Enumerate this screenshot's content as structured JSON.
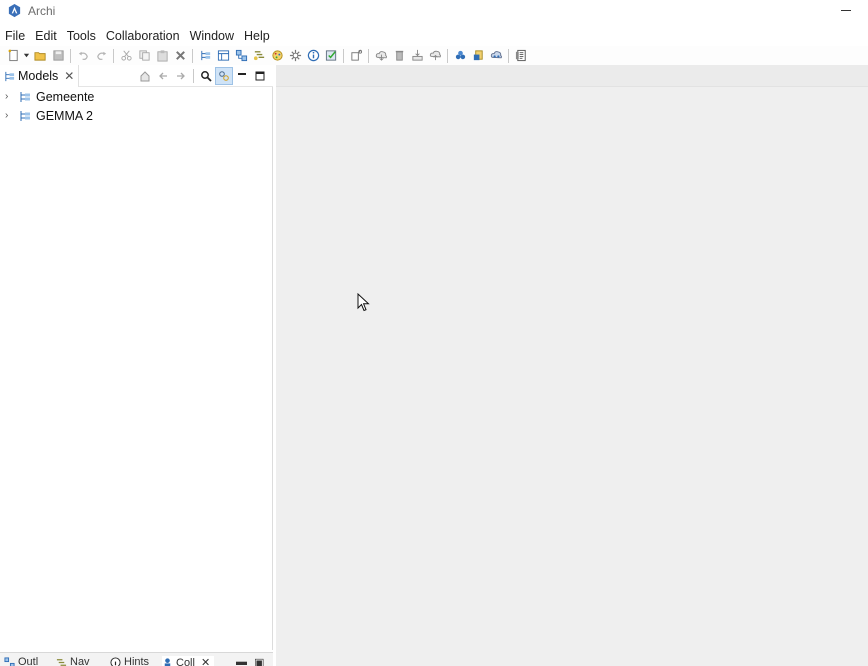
{
  "window": {
    "title": "Archi",
    "icon": "archi-logo-icon",
    "controls": [
      "minimize-icon"
    ]
  },
  "menubar": {
    "items": [
      "File",
      "Edit",
      "Tools",
      "Collaboration",
      "Window",
      "Help"
    ]
  },
  "toolbar": {
    "icons": [
      "new-icon",
      "open-icon",
      "save-icon",
      "undo-icon",
      "redo-icon",
      "cut-icon",
      "copy-icon",
      "paste-icon",
      "delete-icon",
      "models-tree-icon",
      "properties-icon",
      "outline-icon",
      "navigator-icon",
      "palette-icon",
      "hints-icon",
      "info-icon",
      "validator-icon",
      "viewpoint-icon",
      "collab-import-icon",
      "collab-delete-icon",
      "collab-commit-icon",
      "collab-refresh-icon",
      "collab-users-icon",
      "collab-lock-icon",
      "collab-sync-icon",
      "script-icon"
    ]
  },
  "models_panel": {
    "tab_label": "Models",
    "tools": [
      "home-icon",
      "back-icon",
      "forward-icon",
      "search-icon",
      "link-icon",
      "minimize-icon",
      "maximize-icon"
    ],
    "tree": [
      {
        "label": "Gemeente",
        "expanded": false
      },
      {
        "label": "GEMMA 2",
        "expanded": false
      }
    ]
  },
  "bottom_panel": {
    "tabs": [
      "Outl",
      "Nav",
      "Hints",
      "Coll"
    ]
  },
  "colors": {
    "accent": "#2f6db5",
    "active_tool_bg": "#cfe3f7",
    "editor_bg": "#efefef"
  }
}
